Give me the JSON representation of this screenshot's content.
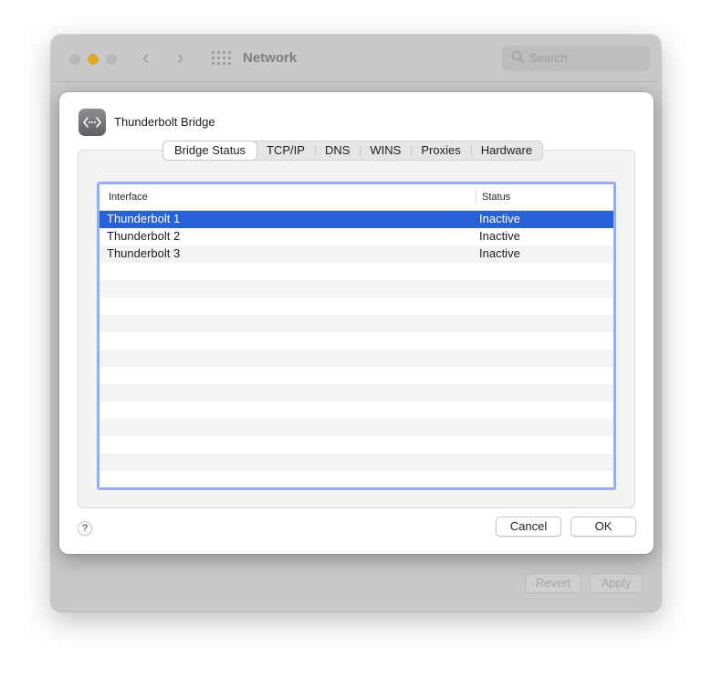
{
  "background_window": {
    "title": "Network",
    "search_placeholder": "Search",
    "revert_label": "Revert",
    "apply_label": "Apply"
  },
  "sheet": {
    "title": "Thunderbolt Bridge",
    "icon": "thunderbolt-bridge-icon",
    "tabs": [
      {
        "label": "Bridge Status",
        "selected": true
      },
      {
        "label": "TCP/IP"
      },
      {
        "label": "DNS"
      },
      {
        "label": "WINS"
      },
      {
        "label": "Proxies"
      },
      {
        "label": "Hardware"
      }
    ],
    "table": {
      "columns": [
        "Interface",
        "Status"
      ],
      "rows": [
        {
          "interface": "Thunderbolt 1",
          "status": "Inactive",
          "selected": true
        },
        {
          "interface": "Thunderbolt 2",
          "status": "Inactive"
        },
        {
          "interface": "Thunderbolt 3",
          "status": "Inactive"
        }
      ]
    },
    "help_label": "?",
    "cancel_label": "Cancel",
    "ok_label": "OK"
  },
  "colors": {
    "selection": "#2860d8",
    "focus_ring": "#94aef0"
  }
}
